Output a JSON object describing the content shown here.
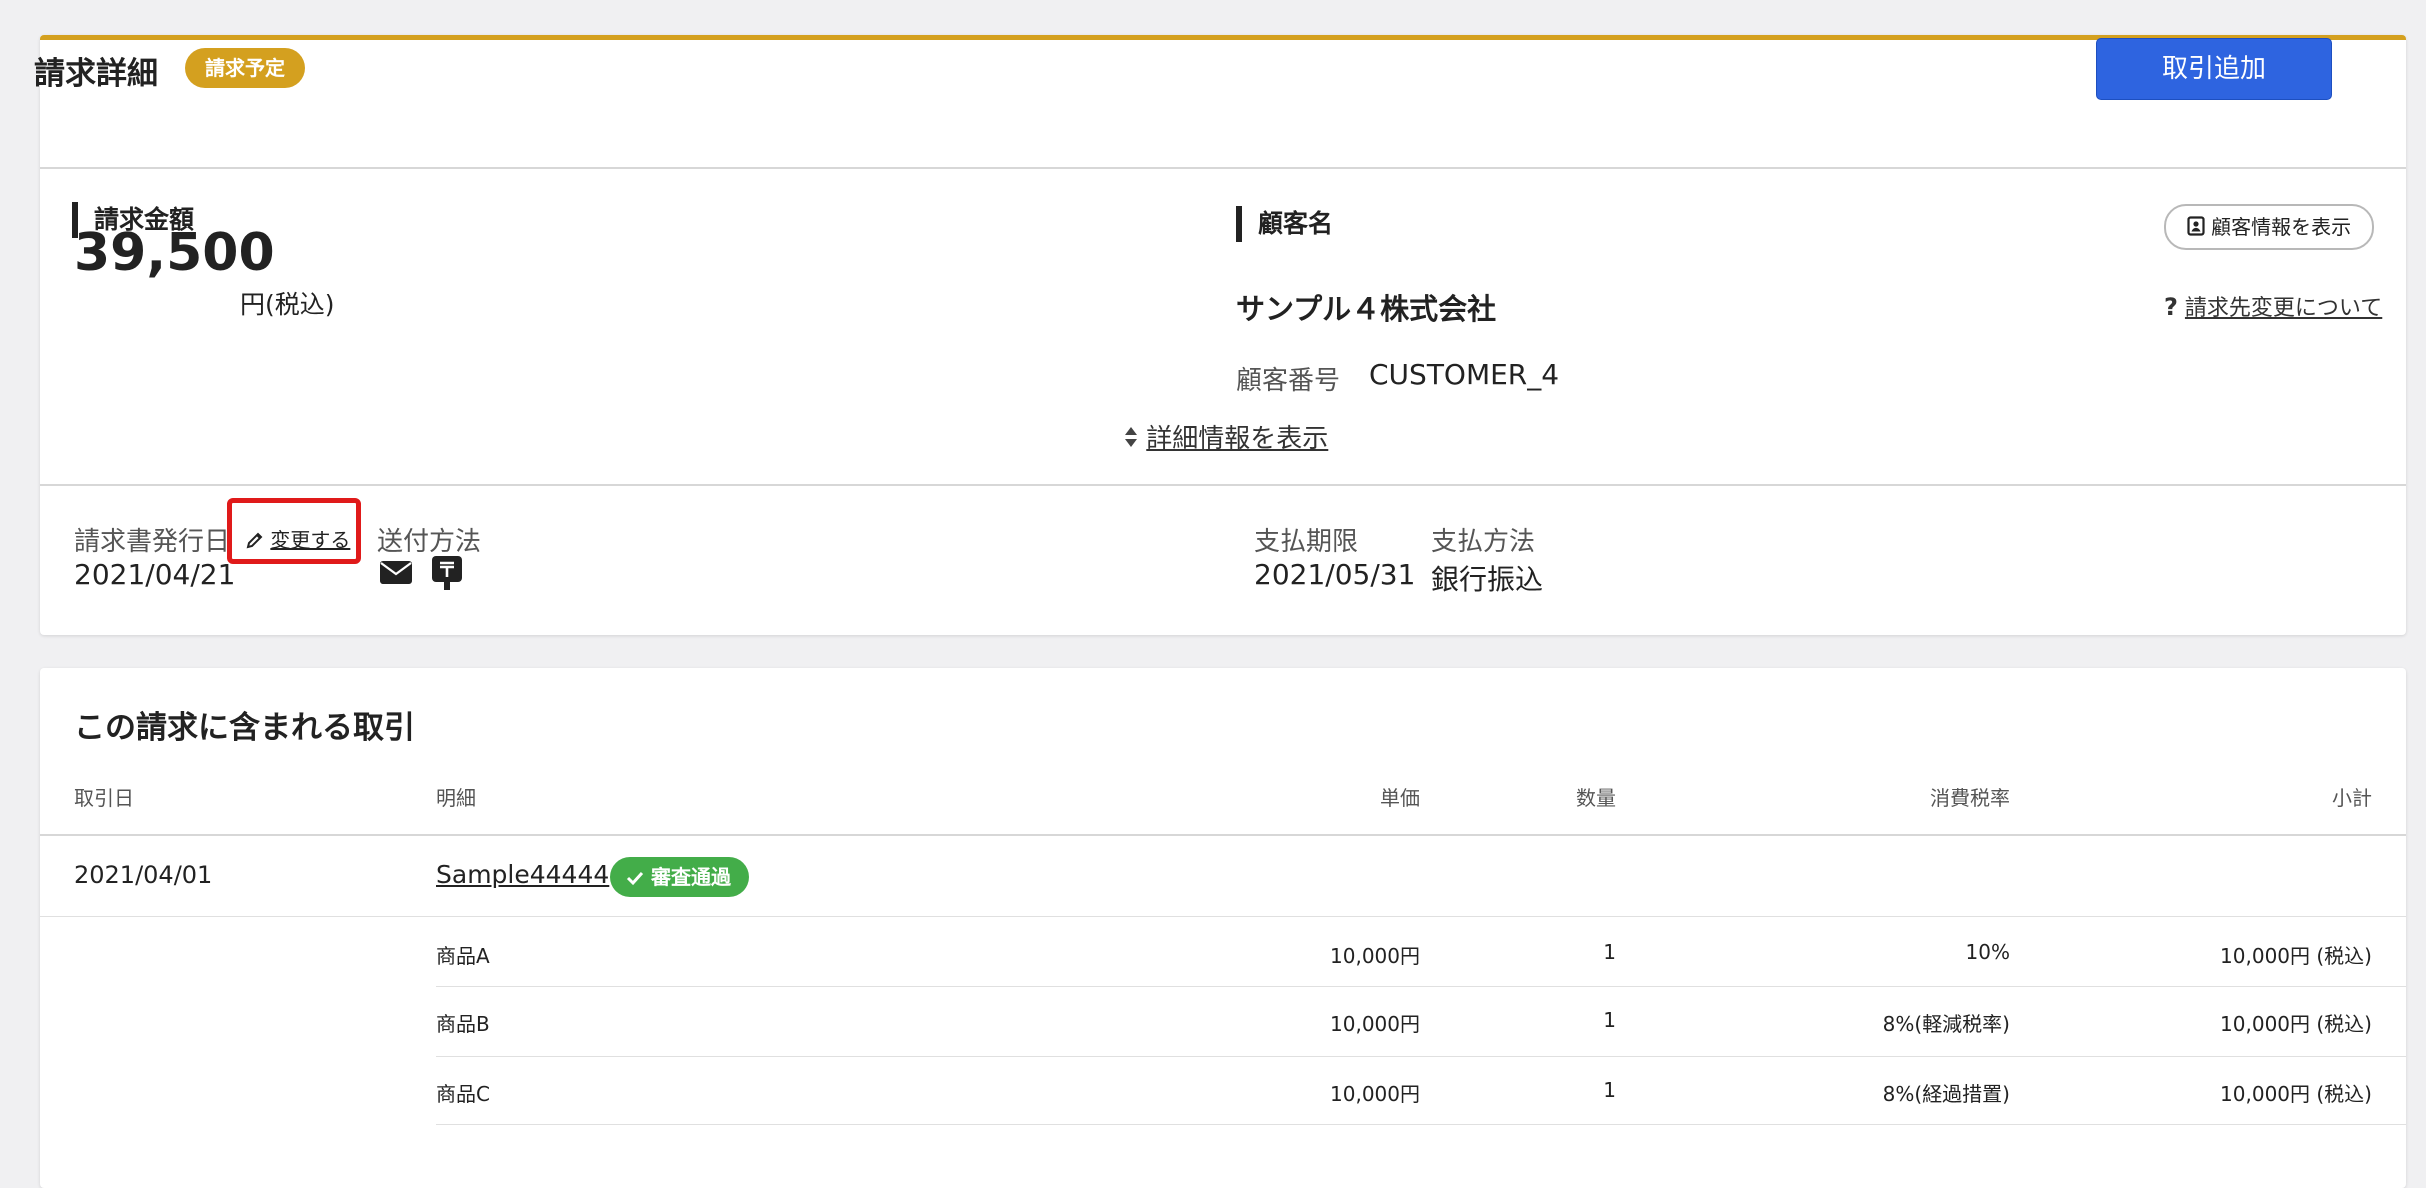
{
  "invoice_header": {
    "title": "請求詳細",
    "status_badge": "請求予定",
    "add_transaction_button": "取引追加"
  },
  "billing_amount": {
    "label": "請求金額",
    "amount": "39,500",
    "unit": "円(税込)"
  },
  "customer": {
    "label": "顧客名",
    "view_info_button": "顧客情報を表示",
    "name": "サンプル４株式会社",
    "change_billing_link": "請求先変更について",
    "number_label": "顧客番号",
    "number": "CUSTOMER_4",
    "show_details_link": "詳細情報を表示"
  },
  "invoice_meta": {
    "issue_date_label": "請求書発行日",
    "change_link": "変更する",
    "issue_date": "2021/04/21",
    "send_method_label": "送付方法",
    "send_method_icons": [
      "envelope-icon",
      "post-icon"
    ],
    "due_date_label": "支払期限",
    "due_date": "2021/05/31",
    "payment_method_label": "支払方法",
    "payment_method": "銀行振込"
  },
  "transactions": {
    "title": "この請求に含まれる取引",
    "columns": {
      "date": "取引日",
      "detail": "明細",
      "unit_price": "単価",
      "quantity": "数量",
      "tax_rate": "消費税率",
      "subtotal": "小計"
    },
    "groups": [
      {
        "date": "2021/04/01",
        "name": "Sample44444",
        "review_badge": "審査通過",
        "items": [
          {
            "name": "商品A",
            "unit_price": "10,000円",
            "quantity": "1",
            "tax_rate": "10%",
            "subtotal": "10,000円 (税込)"
          },
          {
            "name": "商品B",
            "unit_price": "10,000円",
            "quantity": "1",
            "tax_rate": "8%(軽減税率)",
            "subtotal": "10,000円 (税込)"
          },
          {
            "name": "商品C",
            "unit_price": "10,000円",
            "quantity": "1",
            "tax_rate": "8%(経過措置)",
            "subtotal": "10,000円 (税込)"
          }
        ]
      }
    ]
  },
  "colors": {
    "accent_top_border": "#d4a01f",
    "pending_badge": "#d4a01f",
    "primary_button": "#2e64e0",
    "approved_badge": "#43ad49",
    "highlight_box": "#e01a1a"
  }
}
